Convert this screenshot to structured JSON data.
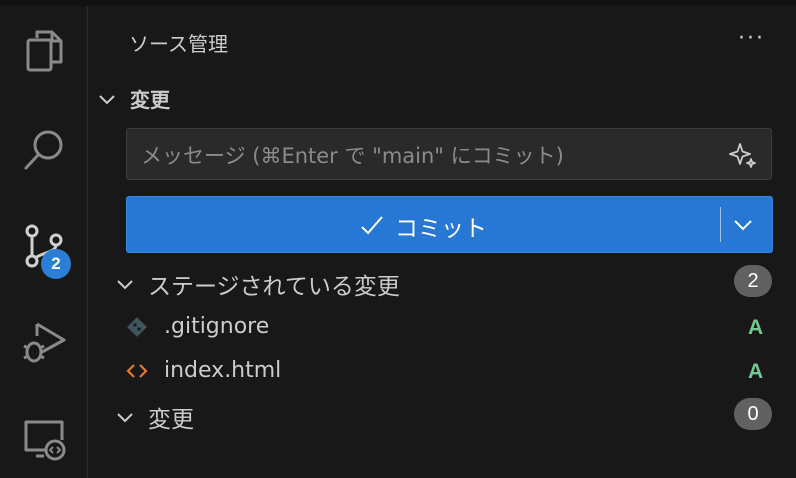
{
  "activity_bar": {
    "items": [
      {
        "name": "explorer",
        "icon": "files-icon"
      },
      {
        "name": "search",
        "icon": "search-icon"
      },
      {
        "name": "source-control",
        "icon": "source-control-icon",
        "badge": "2"
      },
      {
        "name": "run-and-debug",
        "icon": "run-debug-icon"
      },
      {
        "name": "remote-explorer",
        "icon": "remote-explorer-icon"
      }
    ]
  },
  "sidebar": {
    "title": "ソース管理",
    "more_actions": "···",
    "changes_section": {
      "label": "変更",
      "message_placeholder": "メッセージ (⌘Enter で \"main\" にコミット)",
      "commit_button": "コミット"
    },
    "staged_group": {
      "label": "ステージされている変更",
      "count": "2",
      "files": [
        {
          "name": ".gitignore",
          "status": "A",
          "icon": "git-file-icon"
        },
        {
          "name": "index.html",
          "status": "A",
          "icon": "html-file-icon"
        }
      ]
    },
    "unstaged_group": {
      "label": "変更",
      "count": "0"
    }
  },
  "colors": {
    "accent": "#2777d4",
    "added_status": "#73c991",
    "html_icon": "#e37933",
    "git_icon": "#41535b"
  }
}
